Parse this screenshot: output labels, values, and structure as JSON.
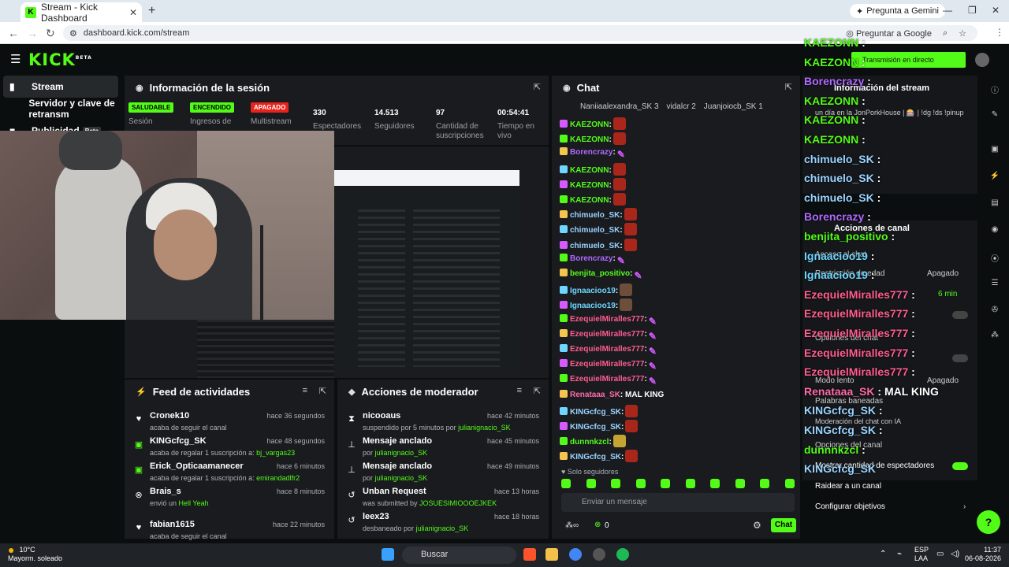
{
  "browser": {
    "tab_title": "Stream - Kick Dashboard",
    "tab_favicon": "K",
    "gemini": "Pregunta a Gemini",
    "url": "dashboard.kick.com/stream",
    "google": "Preguntar a Google"
  },
  "sidebar": {
    "items": [
      {
        "label": "Stream"
      },
      {
        "label": "Servidor y clave de retransm"
      },
      {
        "label": "Publicidad",
        "badge": "Beta"
      }
    ]
  },
  "session": {
    "title": "Información de la sesión",
    "stats": [
      {
        "badge": "SALUDABLE",
        "label": "Sesión"
      },
      {
        "badge": "ENCENDIDO",
        "label": "Ingresos de"
      },
      {
        "badge": "APAGADO",
        "label": "Multistream"
      },
      {
        "value": "330",
        "label": "Espectadores"
      },
      {
        "value": "14.513",
        "label": "Seguidores"
      },
      {
        "value": "97",
        "label": "Cantidad de suscripciones"
      },
      {
        "value": "00:54:41",
        "label": "Tiempo en vivo"
      }
    ]
  },
  "feed": {
    "title": "Feed de actividades",
    "rows": [
      {
        "name": "Cronek10",
        "sub": "acaba de seguir el canal",
        "time": "hace 36 segundos"
      },
      {
        "name": "KINGcfcg_SK",
        "sub": "acaba de regalar 1 suscripción a:",
        "hl": "bj_vargas23",
        "time": "hace 48 segundos"
      },
      {
        "name": "Erick_Opticaamanecer",
        "sub": "acaba de regalar 1 suscripción a:",
        "hl": "emirandadlfr2",
        "time": "hace 6 minutos"
      },
      {
        "name": "Brais_s",
        "sub": "envió un",
        "hl": "Hell Yeah",
        "time": "hace 8 minutos"
      },
      {
        "name": "fabian1615",
        "sub": "acaba de seguir el canal",
        "time": "hace 22 minutos"
      }
    ]
  },
  "mod": {
    "title": "Acciones de moderador",
    "rows": [
      {
        "name": "nicooaus",
        "sub": "suspendido por 5 minutos por",
        "hl": "julianignacio_SK",
        "time": "hace 42 minutos"
      },
      {
        "name": "Mensaje anclado",
        "sub": "por",
        "hl": "julianignacio_SK",
        "time": "hace 45 minutos"
      },
      {
        "name": "Mensaje anclado",
        "sub": "por",
        "hl": "julianignacio_SK",
        "time": "hace 49 minutos"
      },
      {
        "name": "Unban Request",
        "sub": "was submitted by",
        "hl": "JOSUESIMIOOOEJKEK",
        "time": "hace 13 horas"
      },
      {
        "name": "leex23",
        "sub": "desbaneado por",
        "hl": "julianignacio_SK",
        "time": "hace 18 horas"
      }
    ]
  },
  "chat": {
    "title": "Chat",
    "pinned": [
      "Naniiaalexandra_SK 3",
      "vidalcr 2",
      "Juanjoiocb_SK 1"
    ],
    "messages": [
      {
        "user": "KAEZONN",
        "color": "#53fc18",
        "text": ":",
        "emote": "r"
      },
      {
        "user": "KAEZONN",
        "color": "#53fc18",
        "text": ":",
        "emote": "r"
      },
      {
        "user": "Borencrazy",
        "color": "#b069ff",
        "text": ":",
        "emote": "p"
      },
      {
        "user": "KAEZONN",
        "color": "#53fc18",
        "text": ":",
        "emote": "r"
      },
      {
        "user": "KAEZONN",
        "color": "#53fc18",
        "text": ":",
        "emote": "r"
      },
      {
        "user": "KAEZONN",
        "color": "#53fc18",
        "text": ":",
        "emote": "r"
      },
      {
        "user": "chimuelo_SK",
        "color": "#9ad3ff",
        "text": ":",
        "emote": "r"
      },
      {
        "user": "chimuelo_SK",
        "color": "#9ad3ff",
        "text": ":",
        "emote": "r"
      },
      {
        "user": "chimuelo_SK",
        "color": "#9ad3ff",
        "text": ":",
        "emote": "r"
      },
      {
        "user": "Borencrazy",
        "color": "#b069ff",
        "text": ":",
        "emote": "p"
      },
      {
        "user": "benjita_positivo",
        "color": "#53fc18",
        "text": ":",
        "emote": "p"
      },
      {
        "user": "Ignaacioo19",
        "color": "#6fd6ff",
        "text": ":",
        "emote": "b"
      },
      {
        "user": "Ignaacioo19",
        "color": "#6fd6ff",
        "text": ":",
        "emote": "b"
      },
      {
        "user": "EzequielMiralles777",
        "color": "#ff5d8f",
        "text": ":",
        "emote": "p"
      },
      {
        "user": "EzequielMiralles777",
        "color": "#ff5d8f",
        "text": ":",
        "emote": "p"
      },
      {
        "user": "EzequielMiralles777",
        "color": "#ff5d8f",
        "text": ":",
        "emote": "p"
      },
      {
        "user": "EzequielMiralles777",
        "color": "#ff5d8f",
        "text": ":",
        "emote": "p"
      },
      {
        "user": "EzequielMiralles777",
        "color": "#ff5d8f",
        "text": ":",
        "emote": "p"
      },
      {
        "user": "Renataaa_SK",
        "color": "#ff6aa9",
        "text": ": MAL KING",
        "emote": ""
      },
      {
        "user": "KINGcfcg_SK",
        "color": "#9ad3ff",
        "text": ":",
        "emote": "r"
      },
      {
        "user": "KINGcfcg_SK",
        "color": "#9ad3ff",
        "text": ":",
        "emote": "r"
      },
      {
        "user": "dunnnkzcl",
        "color": "#53fc18",
        "text": ":",
        "emote": "g"
      },
      {
        "user": "KINGcfcg_SK",
        "color": "#9ad3ff",
        "text": ":",
        "emote": "r"
      }
    ],
    "followers_only": "Solo seguidores",
    "placeholder": "Enviar un mensaje",
    "points": "0",
    "send": "Chat"
  },
  "overlay": {
    "live_banner": "Transmisión en directo",
    "stream_info": "Información del stream",
    "stream_title": "un día en la JonPorkHouse | 🎰 | !dg !ds !pinup",
    "channel_actions": "Acciones de canal",
    "chat_access": "Acceso al chat",
    "follow_restr": "Restricción de edad",
    "apagado": "Apagado",
    "six_min": "6 min",
    "chat_opts": "Opciones del chat",
    "slow_mode": "Modo lento",
    "banned_words": "Palabras baneadas",
    "mod_chat": "Moderación del chat con IA",
    "channel_opts": "Opciones del canal",
    "show_viewers": "Mostrar cantidad de espectadores",
    "raid": "Raidear a un canal",
    "goals": "Configurar objetivos",
    "big_messages": [
      {
        "user": "KAEZONN",
        "color": "#53fc18",
        "text": ":"
      },
      {
        "user": "KAEZONN",
        "color": "#53fc18",
        "text": ":"
      },
      {
        "user": "Borencrazy",
        "color": "#b069ff",
        "text": ":"
      },
      {
        "user": "KAEZONN",
        "color": "#53fc18",
        "text": ":"
      },
      {
        "user": "KAEZONN",
        "color": "#53fc18",
        "text": ":"
      },
      {
        "user": "KAEZONN",
        "color": "#53fc18",
        "text": ":"
      },
      {
        "user": "chimuelo_SK",
        "color": "#9ad3ff",
        "text": ":"
      },
      {
        "user": "chimuelo_SK",
        "color": "#9ad3ff",
        "text": ":"
      },
      {
        "user": "chimuelo_SK",
        "color": "#9ad3ff",
        "text": ":"
      },
      {
        "user": "Borencrazy",
        "color": "#b069ff",
        "text": ":"
      },
      {
        "user": "benjita_positivo",
        "color": "#53fc18",
        "text": ":"
      },
      {
        "user": "Ignaacioo19",
        "color": "#6fd6ff",
        "text": ":"
      },
      {
        "user": "Ignaacioo19",
        "color": "#6fd6ff",
        "text": ":"
      },
      {
        "user": "EzequielMiralles777",
        "color": "#ff5d8f",
        "text": ":"
      },
      {
        "user": "EzequielMiralles777",
        "color": "#ff5d8f",
        "text": ":"
      },
      {
        "user": "EzequielMiralles777",
        "color": "#ff5d8f",
        "text": ":"
      },
      {
        "user": "EzequielMiralles777",
        "color": "#ff5d8f",
        "text": ":"
      },
      {
        "user": "EzequielMiralles777",
        "color": "#ff5d8f",
        "text": ":"
      },
      {
        "user": "Renataaa_SK",
        "color": "#ff6aa9",
        "text": ": MAL KING"
      },
      {
        "user": "KINGcfcg_SK",
        "color": "#9ad3ff",
        "text": ":"
      },
      {
        "user": "KINGcfcg_SK",
        "color": "#9ad3ff",
        "text": ":"
      },
      {
        "user": "dunnnkzcl",
        "color": "#53fc18",
        "text": ":"
      },
      {
        "user": "KINGcfcg_SK",
        "color": "#9ad3ff",
        "text": ""
      }
    ]
  },
  "taskbar": {
    "temp": "10°C",
    "weather": "Mayorm. soleado",
    "search": "Buscar",
    "lang1": "ESP",
    "lang2": "LAA",
    "time": "11:37",
    "date": "06-08-2026"
  },
  "colors": {
    "accent": "#53fc18",
    "panel": "#191b1f",
    "bg": "#0b0e0f"
  }
}
